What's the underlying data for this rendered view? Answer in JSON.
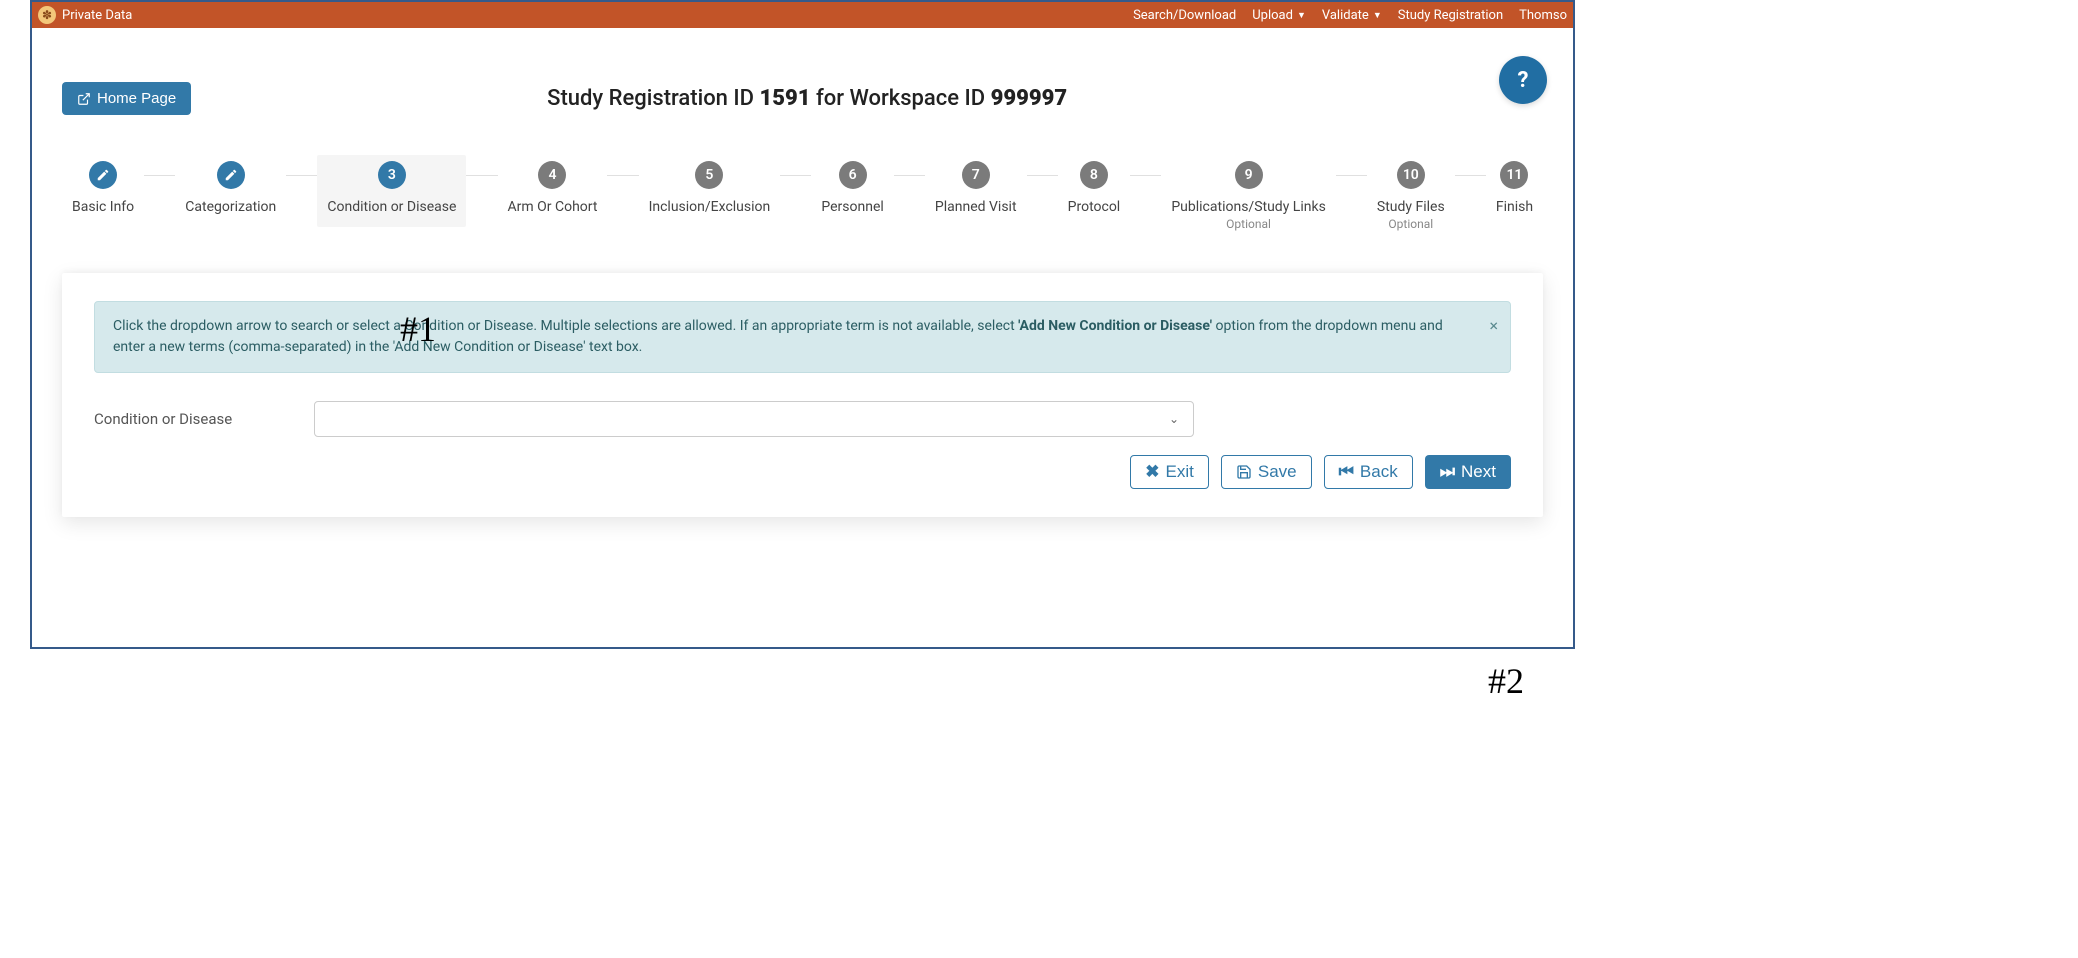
{
  "topbar": {
    "brand": "Private Data",
    "links": [
      {
        "label": "Search/Download",
        "dropdown": false
      },
      {
        "label": "Upload",
        "dropdown": true
      },
      {
        "label": "Validate",
        "dropdown": true
      },
      {
        "label": "Study Registration",
        "dropdown": false
      },
      {
        "label": "Thomso",
        "dropdown": false
      }
    ]
  },
  "help_tooltip": "?",
  "home_button": "Home Page",
  "title": {
    "prefix": "Study Registration ID",
    "reg_id": "1591",
    "middle": "for Workspace ID",
    "ws_id": "999997"
  },
  "steps": [
    {
      "label": "Basic Info",
      "state": "done",
      "num": ""
    },
    {
      "label": "Categorization",
      "state": "done",
      "num": ""
    },
    {
      "label": "Condition or Disease",
      "state": "current",
      "num": "3"
    },
    {
      "label": "Arm Or Cohort",
      "state": "todo",
      "num": "4"
    },
    {
      "label": "Inclusion/Exclusion",
      "state": "todo",
      "num": "5"
    },
    {
      "label": "Personnel",
      "state": "todo",
      "num": "6"
    },
    {
      "label": "Planned Visit",
      "state": "todo",
      "num": "7"
    },
    {
      "label": "Protocol",
      "state": "todo",
      "num": "8"
    },
    {
      "label": "Publications/Study Links",
      "state": "todo",
      "num": "9",
      "sub": "Optional"
    },
    {
      "label": "Study Files",
      "state": "todo",
      "num": "10",
      "sub": "Optional"
    },
    {
      "label": "Finish",
      "state": "todo",
      "num": "11"
    }
  ],
  "info": {
    "part1": "Click the dropdown arrow to search or select a Condition or Disease. Multiple selections are allowed. If an appropriate term is not available, select ",
    "bold": "'Add New Condition or Disease'",
    "part2": " option from the dropdown menu and enter a new terms (comma-separated) in the 'Add New Condition or Disease' text box."
  },
  "form": {
    "condition_label": "Condition or Disease"
  },
  "buttons": {
    "exit": "Exit",
    "save": "Save",
    "back": "Back",
    "next": "Next"
  },
  "annotations": {
    "a1": "#1",
    "a2": "#2"
  }
}
